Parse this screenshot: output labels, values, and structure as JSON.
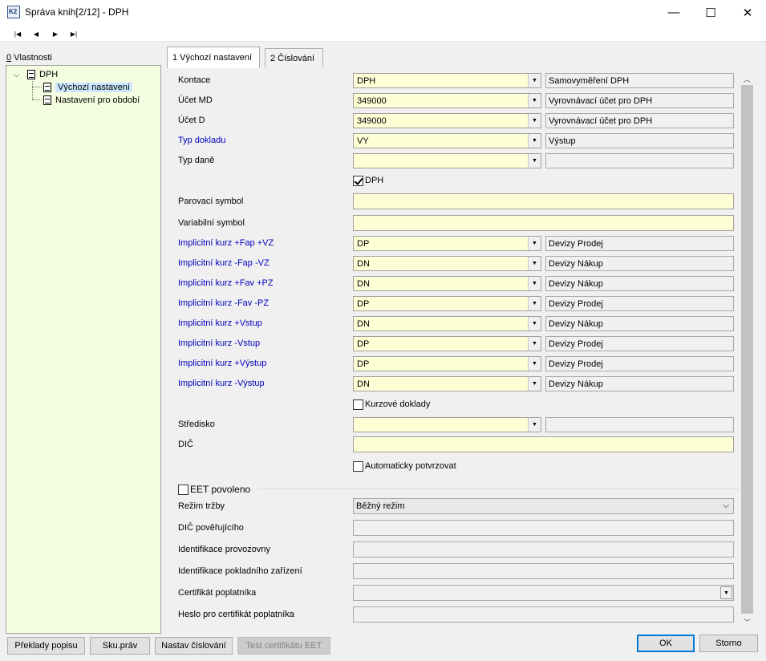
{
  "window": {
    "title": "Správa knih[2/12] - DPH",
    "minimize_glyph": "—",
    "maximize_glyph": "☐",
    "close_glyph": "✕"
  },
  "toolbar": {
    "first_glyph": "|◀",
    "prev_glyph": "◀",
    "next_glyph": "▶",
    "last_glyph": "▶|"
  },
  "left_panel": {
    "label_key": "0",
    "label_rest": " Vlastnosti",
    "tree": {
      "root": "DPH",
      "children": [
        "Výchozí nastavení",
        "Nastavení pro období"
      ]
    }
  },
  "tabs": [
    "1 Výchozí nastavení",
    "2 Číslování"
  ],
  "form": {
    "kontace": {
      "label": "Kontace",
      "value": "DPH",
      "desc": "Samovyměření DPH"
    },
    "ucet_md": {
      "label": "Účet MD",
      "value": "349000",
      "desc": "Vyrovnávací účet pro DPH"
    },
    "ucet_d": {
      "label": "Účet D",
      "value": "349000",
      "desc": "Vyrovnávací účet pro DPH"
    },
    "typ_dokladu": {
      "label": "Typ dokladu",
      "value": "VY",
      "desc": "Výstup"
    },
    "typ_dane": {
      "label": "Typ daně",
      "value": "",
      "desc": ""
    },
    "dph_check": {
      "label": "DPH",
      "checked": true
    },
    "parovaci_symbol": {
      "label": "Parovací symbol",
      "value": ""
    },
    "variabilni_symbol": {
      "label": "Variabilní symbol",
      "value": ""
    },
    "kurzy": [
      {
        "label": "Implicitní kurz +Fap +VZ",
        "value": "DP",
        "desc": "Devizy Prodej"
      },
      {
        "label": "Implicitní kurz -Fap -VZ",
        "value": "DN",
        "desc": "Devizy Nákup"
      },
      {
        "label": "Implicitní kurz +Fav +PZ",
        "value": "DN",
        "desc": "Devizy Nákup"
      },
      {
        "label": "Implicitní kurz -Fav -PZ",
        "value": "DP",
        "desc": "Devizy Prodej"
      },
      {
        "label": "Implicitní kurz +Vstup",
        "value": "DN",
        "desc": "Devizy Nákup"
      },
      {
        "label": "Implicitní kurz -Vstup",
        "value": "DP",
        "desc": "Devizy Prodej"
      },
      {
        "label": "Implicitní kurz +Výstup",
        "value": "DP",
        "desc": "Devizy Prodej"
      },
      {
        "label": "Implicitní kurz -Výstup",
        "value": "DN",
        "desc": "Devizy Nákup"
      }
    ],
    "kurzove_doklady": {
      "label": "Kurzové doklady",
      "checked": false
    },
    "stredisko": {
      "label": "Středisko",
      "value": "",
      "desc": ""
    },
    "dic": {
      "label": "DIČ",
      "value": ""
    },
    "auto_potvrzovat": {
      "label": "Automaticky potvrzovat",
      "checked": false
    }
  },
  "eet": {
    "enabled_label": "EET povoleno",
    "enabled": false,
    "rezim_trzby": {
      "label": "Režim tržby",
      "value": "Běžný režim"
    },
    "dic_poverujiciho": {
      "label": "DIČ pověřujícího",
      "value": ""
    },
    "id_provozovny": {
      "label": "Identifikace provozovny",
      "value": ""
    },
    "id_pokladniho_zarizeni": {
      "label": "Identifikace pokladního zařízení",
      "value": ""
    },
    "certifikat": {
      "label": "Certifikát poplatníka",
      "value": ""
    },
    "heslo": {
      "label": "Heslo pro certifikát poplatníka",
      "value": ""
    }
  },
  "buttons": {
    "preklady": "Překlady popisu",
    "sku_prav": "Sku.práv",
    "nastav_cislovani": "Nastav číslování",
    "test_eet": "Test certifikátu EET",
    "ok": "OK",
    "storno": "Storno"
  },
  "colors": {
    "input_bg": "#ffffd6",
    "tree_bg": "#f5fde0",
    "link_label": "#0000c0",
    "selection": "#cce8ff",
    "ok_border": "#0078d7"
  }
}
